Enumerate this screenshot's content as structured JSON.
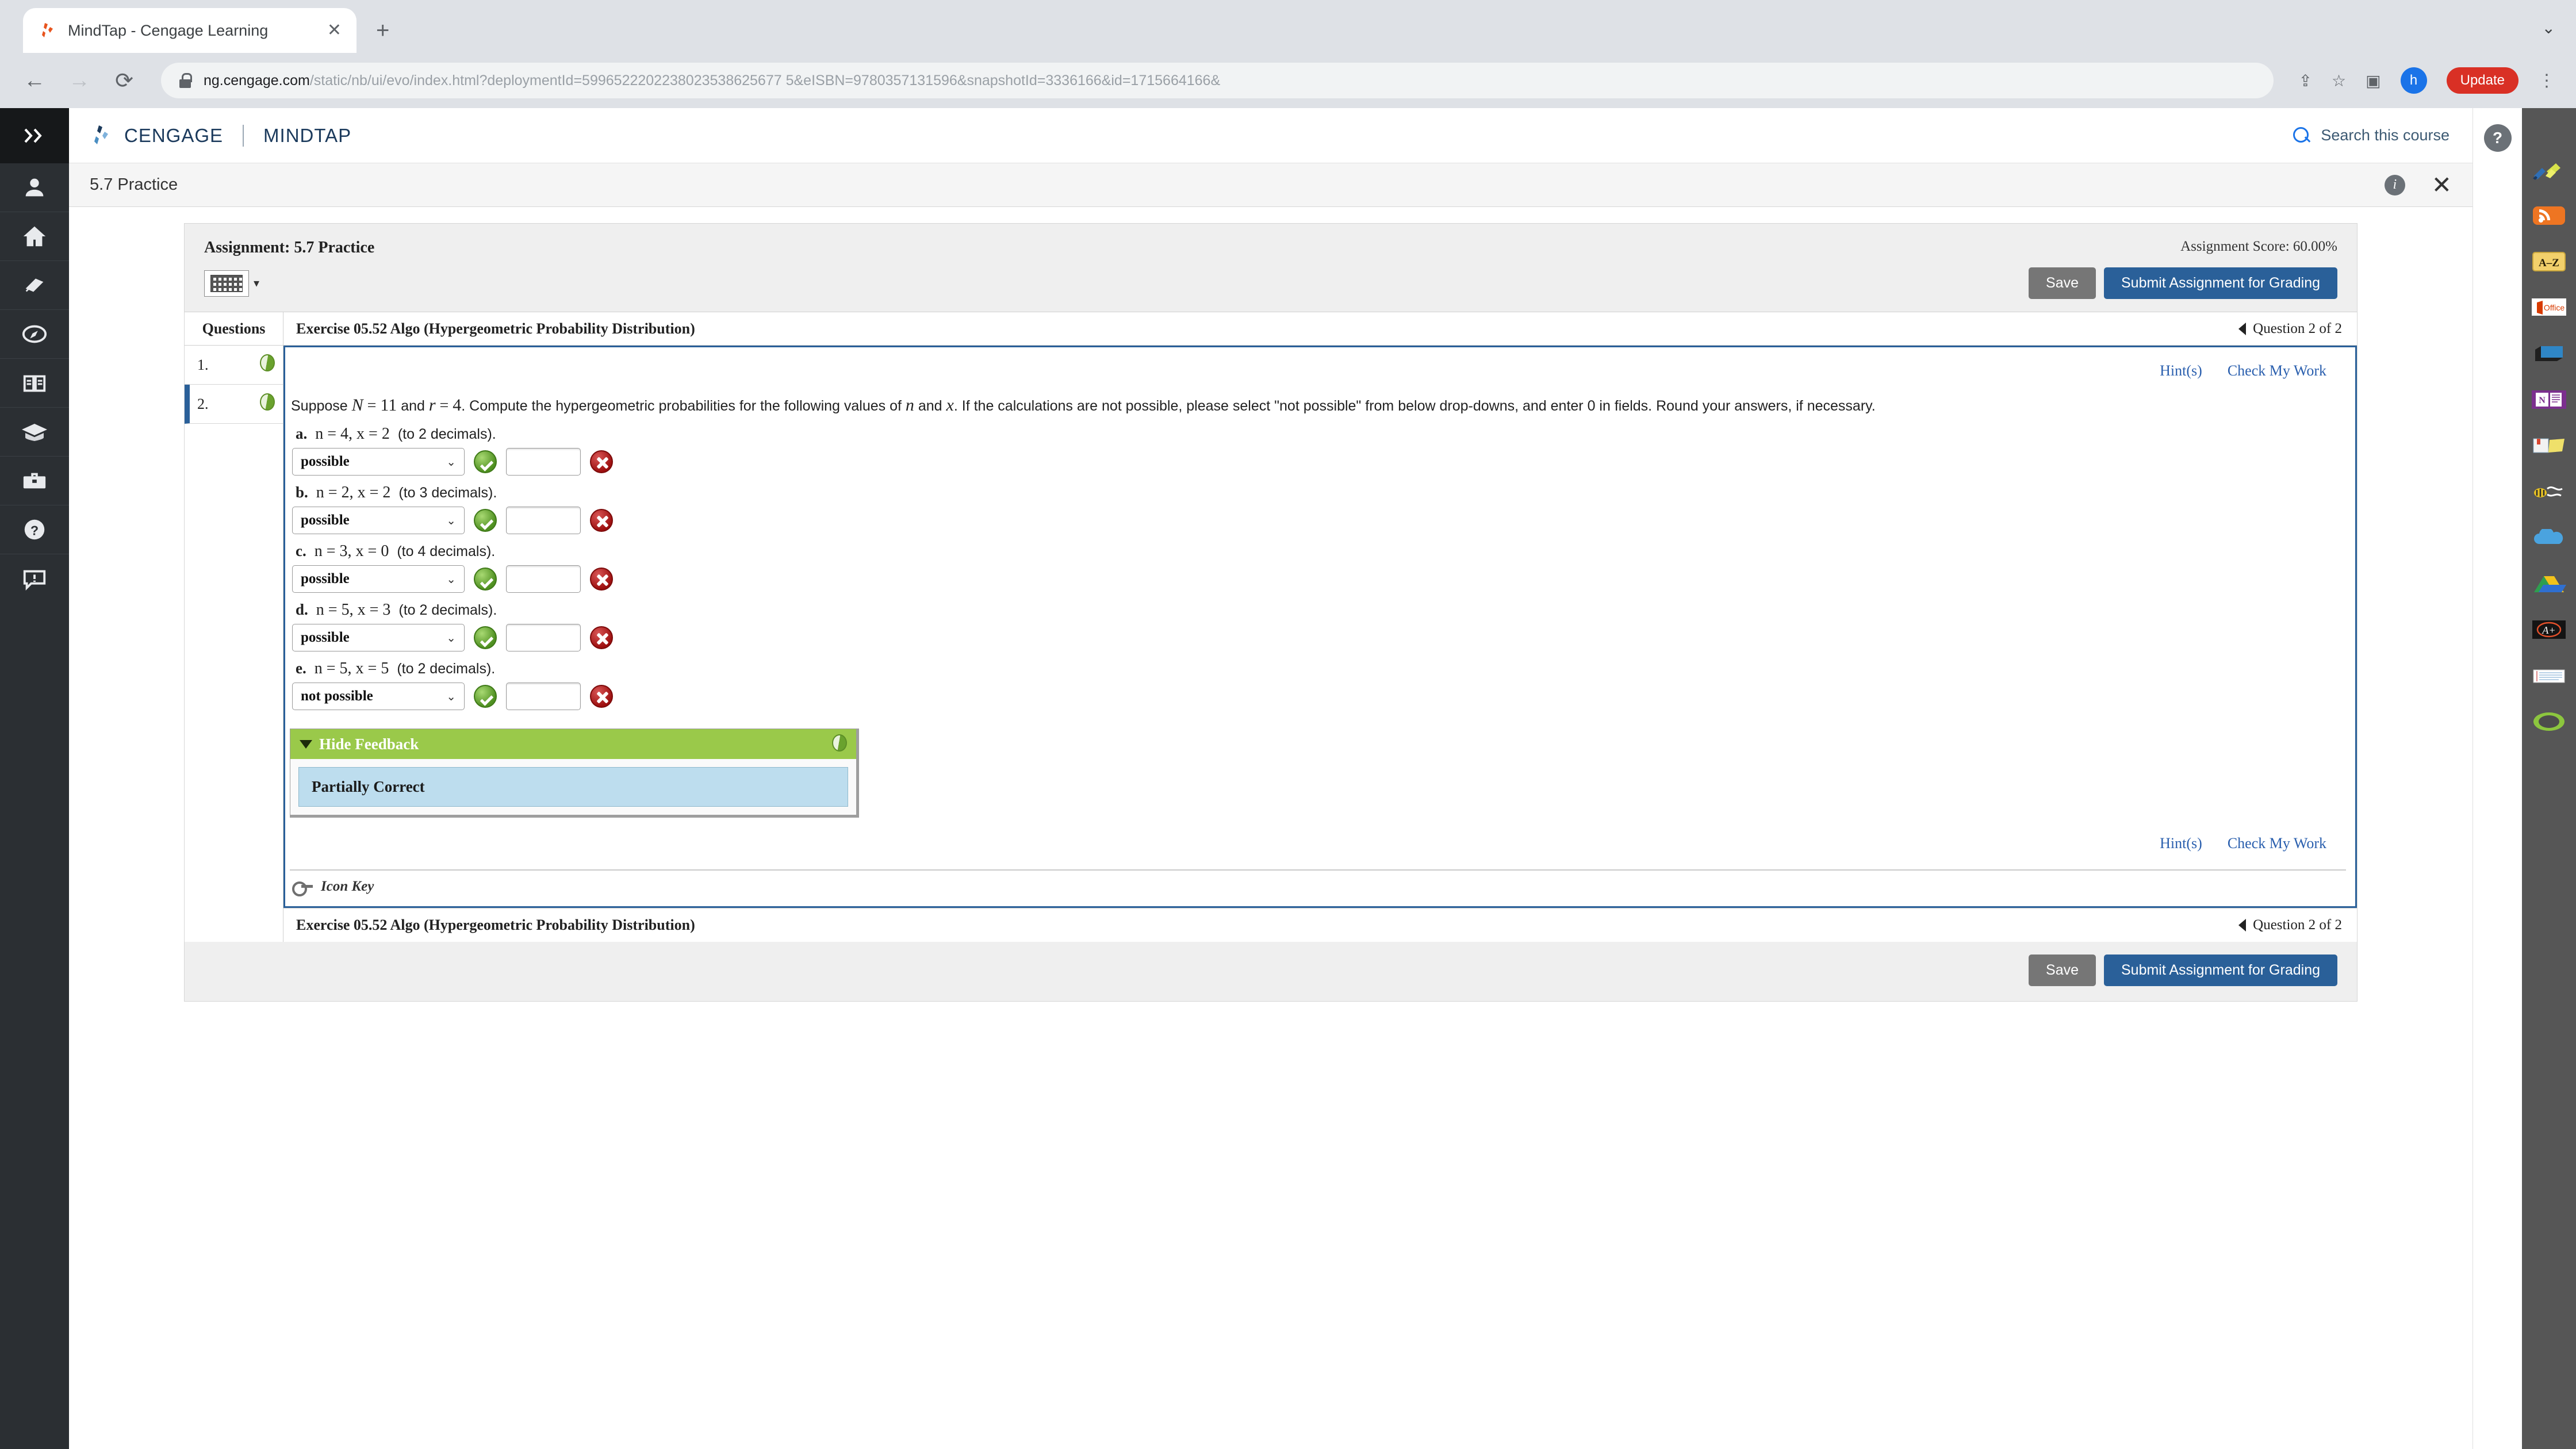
{
  "browser": {
    "tab_title": "MindTap - Cengage Learning",
    "tab_close": "✕",
    "new_tab": "+",
    "window_minimize": "⌄",
    "back": "←",
    "forward": "→",
    "reload": "⟳",
    "url_bold": "ng.cengage.com",
    "url_rest": "/static/nb/ui/evo/index.html?deploymentId=5996522202238023538625677 5&eISBN=9780357131596&snapshotId=3336166&id=1715664166&",
    "share_icon": "⇪",
    "bookmark_icon": "☆",
    "sidepanel_icon": "▣",
    "profile_initial": "h",
    "update_label": "Update",
    "menu_icon": "⋮"
  },
  "left_rail": {
    "expand_label": "»",
    "items": [
      {
        "name": "profile",
        "glyph": "person"
      },
      {
        "name": "home",
        "glyph": "home"
      },
      {
        "name": "notebook",
        "glyph": "notebook"
      },
      {
        "name": "compass",
        "glyph": "compass"
      },
      {
        "name": "reader",
        "glyph": "open-book"
      },
      {
        "name": "grades",
        "glyph": "graduation-cap"
      },
      {
        "name": "toolbox",
        "glyph": "briefcase"
      },
      {
        "name": "help",
        "glyph": "question"
      },
      {
        "name": "announcements",
        "glyph": "announcement"
      }
    ]
  },
  "header": {
    "brand": "CENGAGE",
    "product": "MINDTAP",
    "search_label": "Search this course",
    "page_title": "5.7 Practice",
    "info_label": "i",
    "close_label": "✕"
  },
  "assignment": {
    "title": "Assignment: 5.7 Practice",
    "score": "Assignment Score: 60.00%",
    "save_label": "Save",
    "submit_label": "Submit Assignment for Grading",
    "keyboard_caret": "▾"
  },
  "questions_panel": {
    "header": "Questions",
    "items": [
      {
        "number": "1.",
        "status": "partial-credit"
      },
      {
        "number": "2.",
        "status": "partial-credit"
      }
    ],
    "active_index": 1
  },
  "exercise": {
    "title": "Exercise 05.52 Algo (Hypergeometric Probability Distribution)",
    "nav_label": "Question 2 of 2",
    "hints_label": "Hint(s)",
    "check_label": "Check My Work",
    "stem": {
      "prefix": "Suppose",
      "n_var": "N",
      "eq1": "=",
      "n_val": "11",
      "and": "and",
      "r_var": "r",
      "eq2": "=",
      "r_val": "4",
      "body": ". Compute the hypergeometric probabilities for the following values of",
      "var_n": "n",
      "and2": "and",
      "var_x": "x",
      "tail": ". If the calculations are not possible, please select \"not possible\" from below drop-downs, and enter 0 in fields. Round your answers, if necessary."
    },
    "parts": [
      {
        "letter": "a.",
        "math": "n = 4, x = 2",
        "note": "(to 2 decimals).",
        "select_value": "possible",
        "select_status": "correct",
        "input_value": "",
        "input_status": "incorrect"
      },
      {
        "letter": "b.",
        "math": "n = 2, x = 2",
        "note": "(to 3 decimals).",
        "select_value": "possible",
        "select_status": "correct",
        "input_value": "",
        "input_status": "incorrect"
      },
      {
        "letter": "c.",
        "math": "n = 3, x = 0",
        "note": "(to 4 decimals).",
        "select_value": "possible",
        "select_status": "correct",
        "input_value": "",
        "input_status": "incorrect"
      },
      {
        "letter": "d.",
        "math": "n = 5, x = 3",
        "note": "(to 2 decimals).",
        "select_value": "possible",
        "select_status": "correct",
        "input_value": "",
        "input_status": "incorrect"
      },
      {
        "letter": "e.",
        "math": "n = 5, x = 5",
        "note": "(to 2 decimals).",
        "select_value": "not possible",
        "select_status": "correct",
        "input_value": "",
        "input_status": "incorrect"
      }
    ],
    "select_chevron": "⌄",
    "feedback": {
      "toggle_label": "Hide Feedback",
      "status": "Partially Correct"
    },
    "icon_key_label": "Icon Key"
  },
  "right_rail": {
    "help_label": "?",
    "items": [
      {
        "name": "highlighter"
      },
      {
        "name": "rss"
      },
      {
        "name": "a-z-glossary"
      },
      {
        "name": "office"
      },
      {
        "name": "blue-box"
      },
      {
        "name": "onenote"
      },
      {
        "name": "book-highlight"
      },
      {
        "name": "audio-bee"
      },
      {
        "name": "cloud"
      },
      {
        "name": "google-drive"
      },
      {
        "name": "a-plus"
      },
      {
        "name": "notecards"
      },
      {
        "name": "green-record"
      }
    ]
  },
  "colors": {
    "accent_blue": "#2a6099",
    "link_blue": "#2a5fae",
    "feedback_green": "#9ac94a",
    "banner_blue": "#bdddee",
    "correct_green": "#4f9021",
    "incorrect_red": "#9d0f0f"
  }
}
